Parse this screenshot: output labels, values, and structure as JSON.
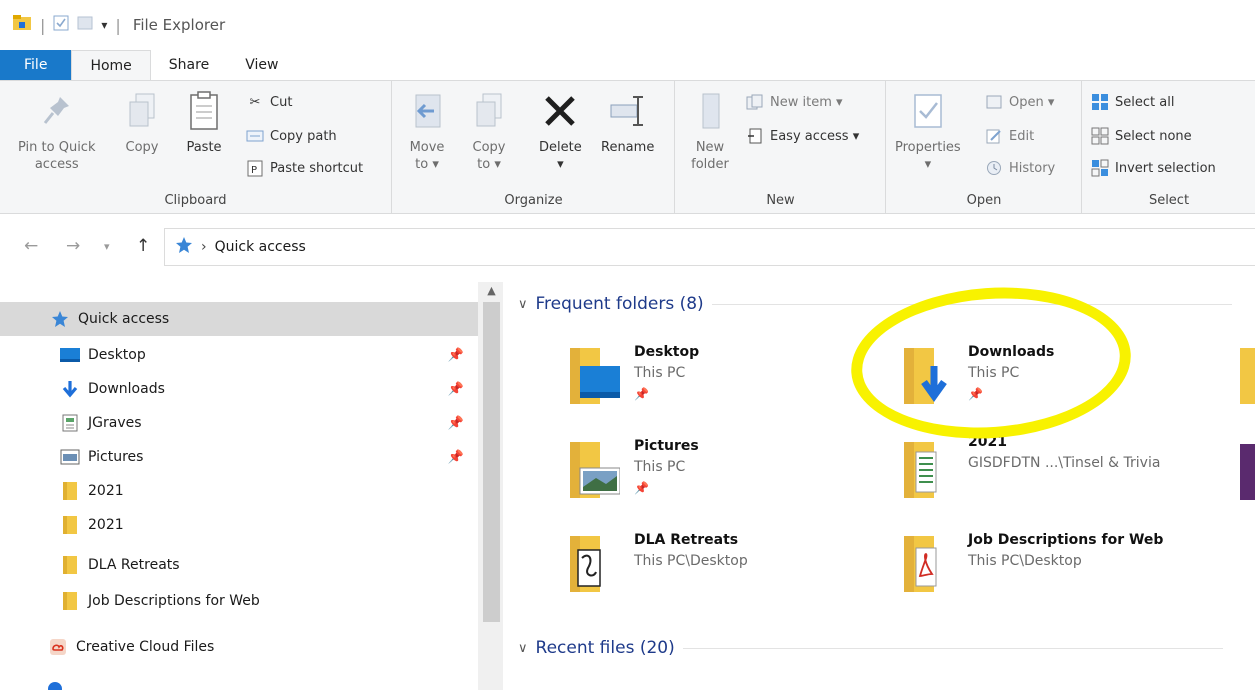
{
  "window": {
    "title": "File Explorer"
  },
  "tabs": [
    {
      "label": "File"
    },
    {
      "label": "Home"
    },
    {
      "label": "Share"
    },
    {
      "label": "View"
    }
  ],
  "ribbon": {
    "clipboard": {
      "label": "Clipboard",
      "pin_line1": "Pin to Quick",
      "pin_line2": "access",
      "copy": "Copy",
      "paste": "Paste",
      "cut": "Cut",
      "copy_path": "Copy path",
      "paste_shortcut": "Paste shortcut"
    },
    "organize": {
      "label": "Organize",
      "move_line1": "Move",
      "move_line2": "to ▾",
      "copy_line1": "Copy",
      "copy_line2": "to ▾",
      "delete": "Delete",
      "delete_arrow": "▾",
      "rename": "Rename"
    },
    "new": {
      "label": "New",
      "folder_line1": "New",
      "folder_line2": "folder",
      "new_item": "New item ▾",
      "easy_access": "Easy access ▾"
    },
    "open": {
      "label": "Open",
      "properties": "Properties",
      "properties_arrow": "▾",
      "open": "Open ▾",
      "edit": "Edit",
      "history": "History"
    },
    "select": {
      "label": "Select",
      "select_all": "Select all",
      "select_none": "Select none",
      "invert": "Invert selection"
    }
  },
  "address": {
    "path": "Quick access",
    "separator": "›"
  },
  "nav": {
    "quick_access": "Quick access",
    "items": [
      {
        "label": "Desktop",
        "pinned": true
      },
      {
        "label": "Downloads",
        "pinned": true
      },
      {
        "label": "JGraves",
        "pinned": true
      },
      {
        "label": "Pictures",
        "pinned": true
      },
      {
        "label": "2021",
        "pinned": false
      },
      {
        "label": "2021",
        "pinned": false
      },
      {
        "label": "DLA Retreats",
        "pinned": false
      },
      {
        "label": "Job Descriptions for Web",
        "pinned": false
      }
    ],
    "creative_cloud": "Creative Cloud Files"
  },
  "content": {
    "frequent_header": "Frequent folders (8)",
    "recent_header": "Recent files (20)",
    "folders": [
      {
        "name": "Desktop",
        "location": "This PC",
        "pinned": true
      },
      {
        "name": "Downloads",
        "location": "This PC",
        "pinned": true
      },
      {
        "name": "Pictures",
        "location": "This PC",
        "pinned": true
      },
      {
        "name": "2021",
        "location": "GISDFDTN ...\\Tinsel & Trivia",
        "pinned": false
      },
      {
        "name": "DLA Retreats",
        "location": "This PC\\Desktop",
        "pinned": false
      },
      {
        "name": "Job Descriptions for Web",
        "location": "This PC\\Desktop",
        "pinned": false
      }
    ]
  },
  "colors": {
    "file_tab": "#1979ca",
    "folder_yellow": "#f2c744",
    "accent_blue": "#1e6fd9",
    "annotation": "#f8f200"
  }
}
